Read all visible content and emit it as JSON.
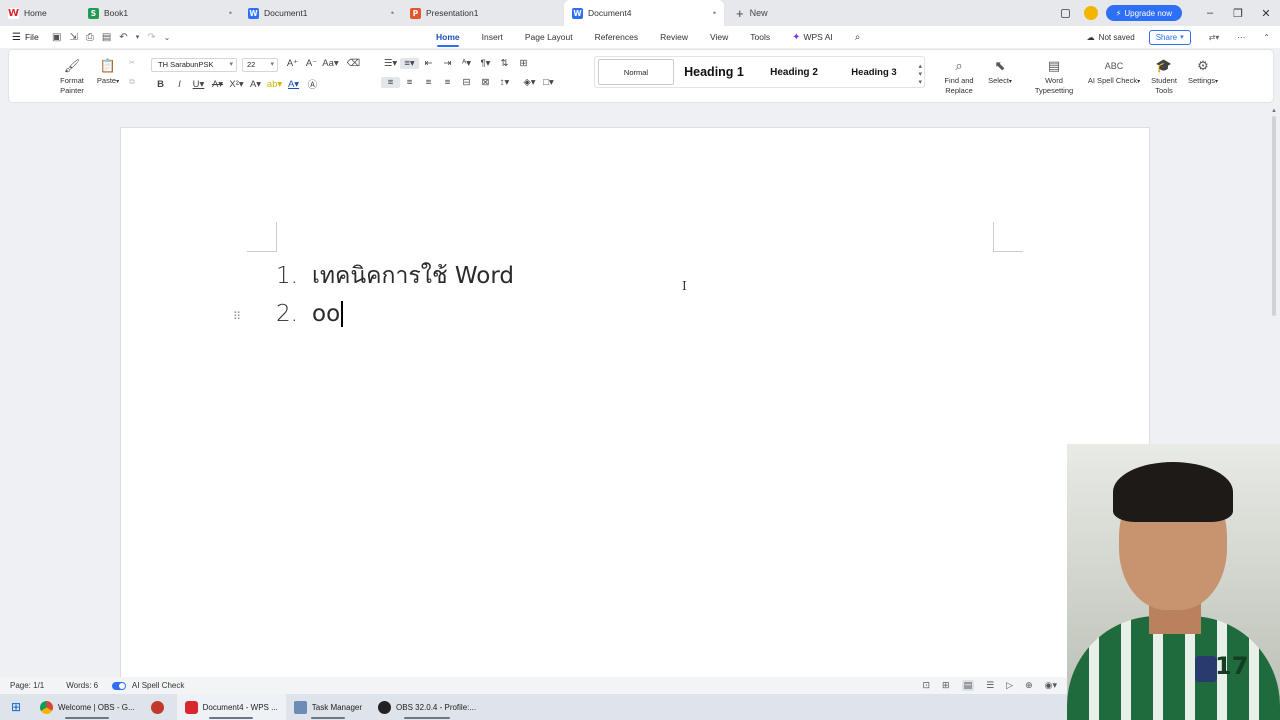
{
  "tabs": [
    {
      "label": "Home",
      "icon": "wps-logo-icon",
      "color": "#d9272e",
      "glyph": "W"
    },
    {
      "label": "Book1",
      "icon": "spreadsheet-icon",
      "color": "#1f9d55",
      "glyph": "S"
    },
    {
      "label": "Document1",
      "icon": "writer-icon",
      "color": "#2d6ff7",
      "glyph": "W"
    },
    {
      "label": "Presentation1",
      "icon": "presentation-icon",
      "color": "#e4572e",
      "glyph": "P"
    },
    {
      "label": "Document4",
      "icon": "writer-icon",
      "color": "#2d6ff7",
      "glyph": "W"
    }
  ],
  "new_tab_label": "New",
  "upgrade_label": "Upgrade now",
  "menu": {
    "file_label": "File",
    "tabs": [
      "Home",
      "Insert",
      "Page Layout",
      "References",
      "Review",
      "View",
      "Tools"
    ],
    "active_tab": "Home",
    "wps_ai_label": "WPS AI",
    "not_saved_label": "Not saved",
    "share_label": "Share"
  },
  "ribbon": {
    "format_painter_label": "Format Painter",
    "paste_label": "Paste",
    "font_name": "TH SarabunPSK",
    "font_size": "22",
    "styles": {
      "normal": "Normal",
      "heading1": "Heading 1",
      "heading2": "Heading 2",
      "heading3": "Heading 3"
    },
    "find_replace_label": "Find and Replace",
    "select_label": "Select",
    "word_typesetting_label": "Word Typesetting",
    "ai_spell_check_label": "AI Spell Check",
    "student_tools_label": "Student Tools",
    "settings_label": "Settings"
  },
  "document": {
    "list_items": [
      {
        "number": "1.",
        "text": "เทคนิคการใช้ Word"
      },
      {
        "number": "2.",
        "text": "oo"
      }
    ]
  },
  "status": {
    "page": "Page: 1/1",
    "words": "Words: 6",
    "spell_check": "AI Spell Check"
  },
  "taskbar": [
    {
      "label": "Welcome | OBS - G...",
      "color": "#4285f4",
      "active": false
    },
    {
      "label": "",
      "color": "#c0392b",
      "active": false
    },
    {
      "label": "Document4 - WPS ...",
      "color": "#d9272e",
      "active": true
    },
    {
      "label": "Task Manager",
      "color": "#6b8db5",
      "active": false
    },
    {
      "label": "OBS 32.0.4 - Profile:...",
      "color": "#222222",
      "active": false
    }
  ],
  "colors": {
    "accent": "#2d6ff7",
    "page": "#ffffff",
    "canvas": "#eef0f3"
  }
}
